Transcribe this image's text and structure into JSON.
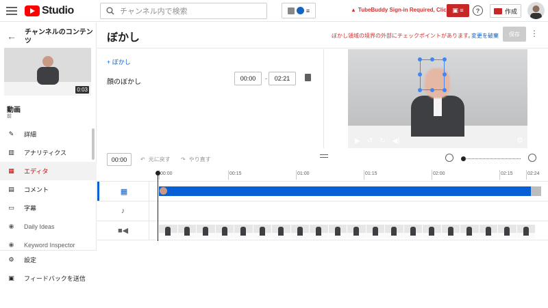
{
  "topbar": {
    "logo_text": "Studio",
    "search_placeholder": "チャンネル内で検索",
    "tubebuddy_warning": "TubeBuddy Sign-in Required, Click Here",
    "create_label": "作成",
    "help_glyph": "?"
  },
  "sidebar": {
    "back_glyph": "←",
    "title": "チャンネルのコンテンツ",
    "thumb_duration": "0:03",
    "video_label": "動画",
    "video_sub": "前",
    "items": [
      {
        "label": "詳細",
        "icon": "pencil-icon"
      },
      {
        "label": "アナリティクス",
        "icon": "analytics-icon"
      },
      {
        "label": "エディタ",
        "icon": "editor-icon",
        "active": true
      },
      {
        "label": "コメント",
        "icon": "comment-icon"
      },
      {
        "label": "字幕",
        "icon": "subtitles-icon"
      },
      {
        "label": "Daily Ideas",
        "icon": "play-circle-icon"
      },
      {
        "label": "Keyword Inspector",
        "icon": "play-circle-icon"
      }
    ],
    "bottom": [
      {
        "label": "設定",
        "icon": "gear-icon"
      },
      {
        "label": "フィードバックを送信",
        "icon": "feedback-icon"
      }
    ]
  },
  "header": {
    "title": "ぼかし",
    "warning": "ぼかし領域の境界の外部にチェックポイントがあります。",
    "discard_label": "変更を破棄",
    "save_label": "保存",
    "more_glyph": "⋮"
  },
  "blur": {
    "add_label": "+ ぼかし",
    "face_blur_label": "顔のぼかし",
    "start": "00:00",
    "dash": "-",
    "end": "02:21"
  },
  "timeline": {
    "current_time": "00:00",
    "undo_label": "元に戻す",
    "redo_label": "やり直す",
    "ticks": [
      "00:00",
      "00:15",
      "01:00",
      "01:15",
      "02:00",
      "02:15",
      "02:24"
    ]
  },
  "colors": {
    "accent_blue": "#065fd4",
    "warning_red": "#d32f2f",
    "active_red": "#cc0000"
  }
}
